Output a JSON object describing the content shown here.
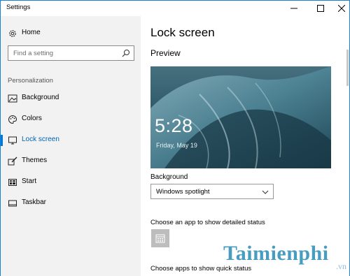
{
  "window": {
    "title": "Settings"
  },
  "sidebar": {
    "home_label": "Home",
    "search_placeholder": "Find a setting",
    "section_label": "Personalization",
    "items": [
      {
        "label": "Background",
        "icon": "picture-icon",
        "active": false
      },
      {
        "label": "Colors",
        "icon": "palette-icon",
        "active": false
      },
      {
        "label": "Lock screen",
        "icon": "monitor-icon",
        "active": true
      },
      {
        "label": "Themes",
        "icon": "brush-icon",
        "active": false
      },
      {
        "label": "Start",
        "icon": "start-tiles-icon",
        "active": false
      },
      {
        "label": "Taskbar",
        "icon": "taskbar-icon",
        "active": false
      }
    ]
  },
  "content": {
    "title": "Lock screen",
    "preview_label": "Preview",
    "preview_time": "5:28",
    "preview_date": "Friday, May 19",
    "background_label": "Background",
    "background_value": "Windows spotlight",
    "detailed_status_label": "Choose an app to show detailed status",
    "detailed_status_app_icon": "calendar-icon",
    "quick_status_label": "Choose apps to show quick status"
  },
  "watermark": {
    "main": "Taimienphi",
    "sub": ".vn"
  },
  "colors": {
    "accent": "#0078d7",
    "sidebar_bg": "#f2f2f2",
    "tile": "#bdbdbd"
  }
}
